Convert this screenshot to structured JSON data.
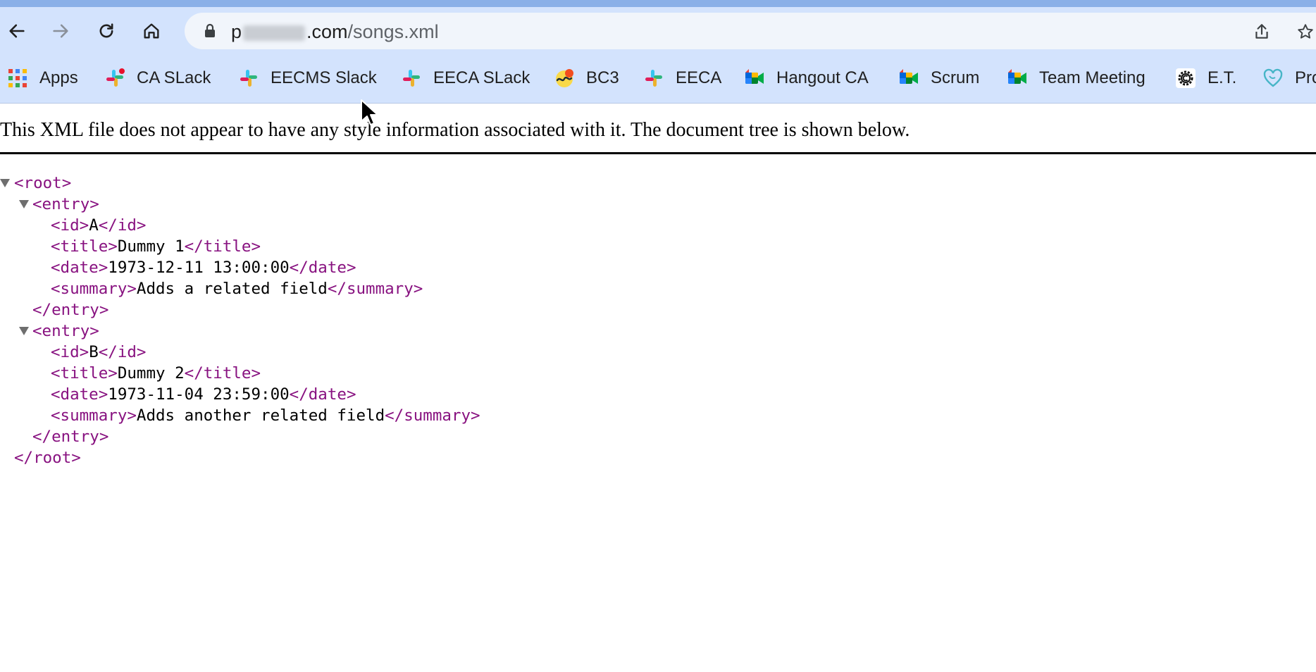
{
  "browser": {
    "url_prefix": "p",
    "url_domain_suffix": ".com",
    "url_path": "/songs.xml"
  },
  "bookmarks": [
    {
      "label": "Apps",
      "icon": "apps-grid-icon"
    },
    {
      "label": "CA SLack",
      "icon": "slack-icon"
    },
    {
      "label": "EECMS Slack",
      "icon": "slack-icon"
    },
    {
      "label": "EECA SLack",
      "icon": "slack-icon"
    },
    {
      "label": "BC3",
      "icon": "basecamp-icon"
    },
    {
      "label": "EECA",
      "icon": "slack-icon"
    },
    {
      "label": "Hangout CA",
      "icon": "google-meet-icon"
    },
    {
      "label": "Scrum",
      "icon": "google-meet-icon"
    },
    {
      "label": "Team Meeting",
      "icon": "google-meet-icon"
    },
    {
      "label": "E.T.",
      "icon": "gear-logo-icon"
    },
    {
      "label": "Pro",
      "icon": "heart-logo-icon"
    }
  ],
  "notice": "This XML file does not appear to have any style information associated with it. The document tree is shown below.",
  "xml": {
    "root_open": "<root>",
    "root_close": "</root>",
    "entries": [
      {
        "open": "<entry>",
        "close": "</entry>",
        "fields": [
          {
            "open": "<id>",
            "value": "A",
            "close": "</id>"
          },
          {
            "open": "<title>",
            "value": "Dummy 1",
            "close": "</title>"
          },
          {
            "open": "<date>",
            "value": "1973-12-11 13:00:00",
            "close": "</date>"
          },
          {
            "open": "<summary>",
            "value": "Adds a related field",
            "close": "</summary>"
          }
        ]
      },
      {
        "open": "<entry>",
        "close": "</entry>",
        "fields": [
          {
            "open": "<id>",
            "value": "B",
            "close": "</id>"
          },
          {
            "open": "<title>",
            "value": "Dummy 2",
            "close": "</title>"
          },
          {
            "open": "<date>",
            "value": "1973-11-04 23:59:00",
            "close": "</date>"
          },
          {
            "open": "<summary>",
            "value": "Adds another related field",
            "close": "</summary>"
          }
        ]
      }
    ]
  },
  "colors": {
    "toolbar": "#d3e3fd",
    "xml_tag": "#881280"
  }
}
